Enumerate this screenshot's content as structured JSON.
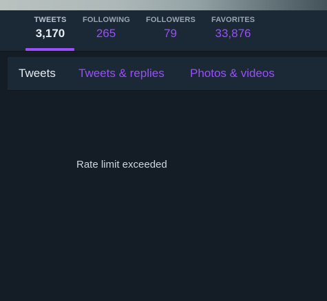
{
  "profile_stats": {
    "tweets": {
      "label": "TWEETS",
      "value": "3,170"
    },
    "following": {
      "label": "FOLLOWING",
      "value": "265"
    },
    "followers": {
      "label": "FOLLOWERS",
      "value": "79"
    },
    "favorites": {
      "label": "FAVORITES",
      "value": "33,876"
    },
    "active_stat": "tweets"
  },
  "timeline_tabs": [
    {
      "label": "Tweets",
      "active": true
    },
    {
      "label": "Tweets & replies",
      "active": false
    },
    {
      "label": "Photos & videos",
      "active": false
    }
  ],
  "stream": {
    "message": "Rate limit exceeded"
  },
  "colors": {
    "background": "#141d26",
    "panel": "#1b2836",
    "accent": "#9b4dff",
    "text_primary": "#e6ecf0",
    "text_muted": "#9aa6b2"
  }
}
